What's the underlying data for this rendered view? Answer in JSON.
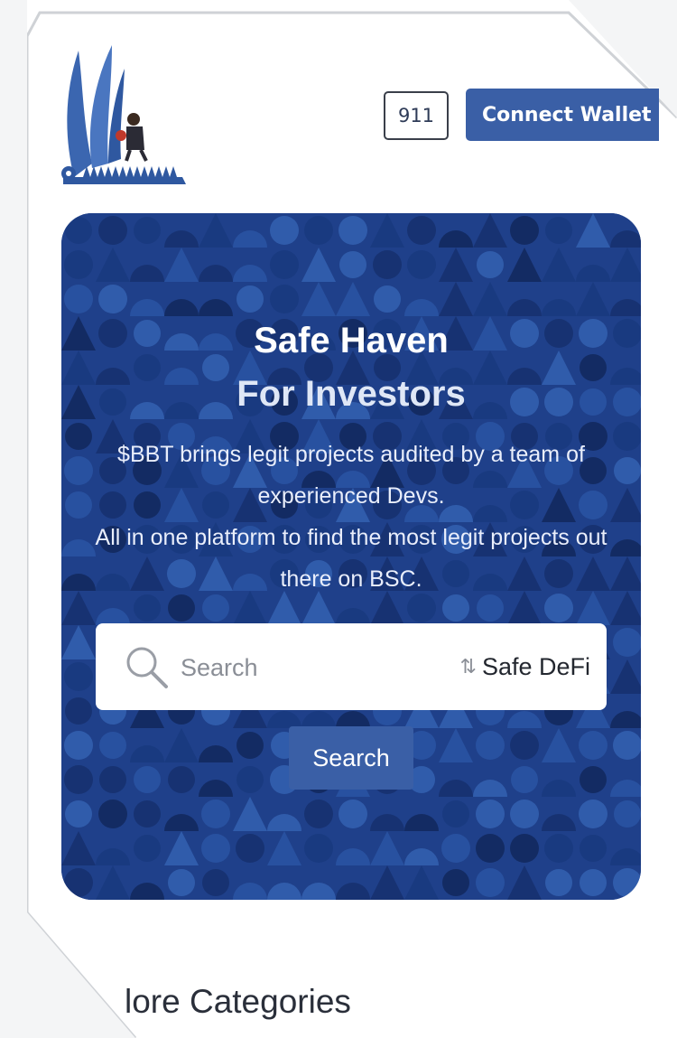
{
  "header": {
    "notify_label": "911",
    "wallet_label": "Connect Wallet"
  },
  "hero": {
    "title_line1": "Safe Haven",
    "title_line2": "For Investors",
    "desc_line1": "$BBT brings legit projects audited by a team of experienced Devs.",
    "desc_line2": "All in one platform to find the most legit projects out there on BSC."
  },
  "search": {
    "placeholder": "Search",
    "filter_value": "Safe DeFi",
    "button_label": "Search"
  },
  "sections": {
    "categories_title": "lore Categories"
  },
  "colors": {
    "brand": "#3a5fa6",
    "hero_bg": "#1d3d86"
  },
  "icons": [
    "logo-icon",
    "search-icon",
    "sort-icon"
  ]
}
